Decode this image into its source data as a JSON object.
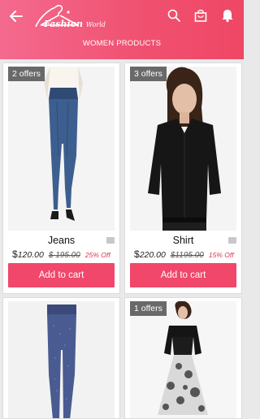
{
  "header": {
    "title": "Fashion World",
    "title_main": "Fashion",
    "title_small": "World",
    "subtitle": "WOMEN PRODUCTS",
    "icons": [
      "back-arrow-icon",
      "search-icon",
      "shopping-bag-icon",
      "bell-icon"
    ]
  },
  "products": [
    {
      "offer": "2 offers",
      "name": "Jeans",
      "price_symbol": "$",
      "price": "120.00",
      "mrp": "$ 195.00",
      "discount": "25% Off",
      "button": "Add to cart"
    },
    {
      "offer": "3 offers",
      "name": "Shirt",
      "price_symbol": "$",
      "price": "220.00",
      "mrp": "$1195.00",
      "discount": "15% Off",
      "button": "Add to cart"
    },
    {
      "offer": "",
      "name": "",
      "price_symbol": "",
      "price": "",
      "mrp": "",
      "discount": "",
      "button": ""
    },
    {
      "offer": "1 offers",
      "name": "",
      "price_symbol": "",
      "price": "",
      "mrp": "",
      "discount": "",
      "button": ""
    }
  ],
  "colors": {
    "header_start": "#f46a8f",
    "header_end": "#ef4766",
    "button": "#f0476b",
    "discount": "#e0324f"
  }
}
